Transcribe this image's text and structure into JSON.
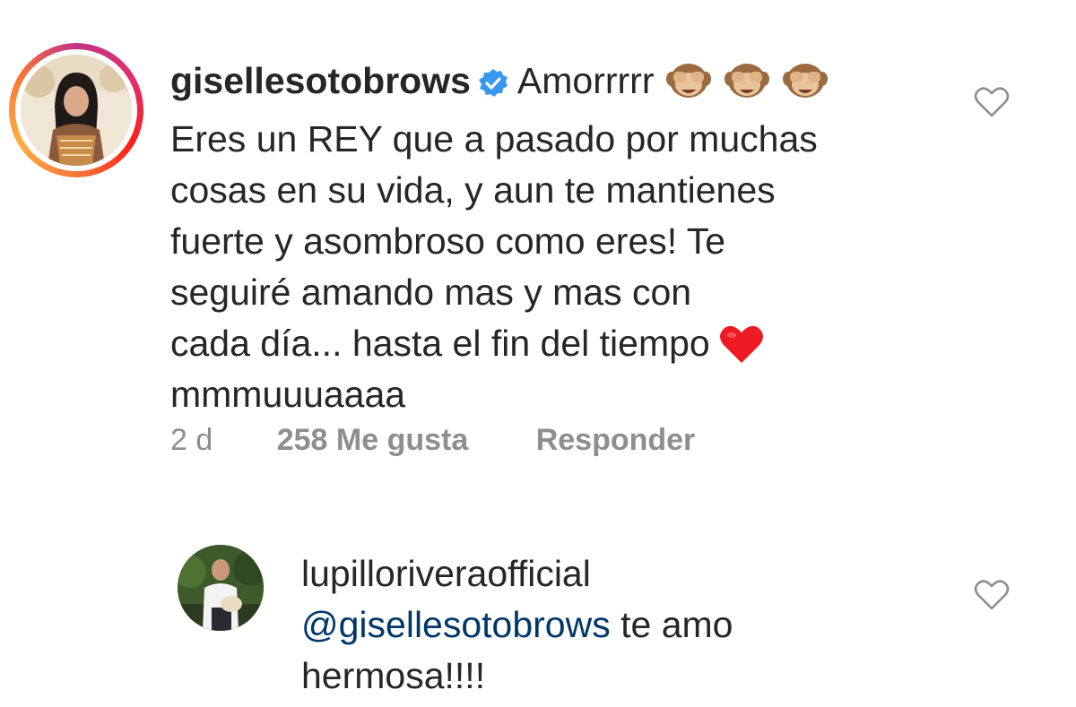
{
  "comments": [
    {
      "username": "gisellesotobrows",
      "verified": true,
      "text_first": "Amorrrrr",
      "emojis": [
        "see-no-evil-monkey",
        "see-no-evil-monkey",
        "see-no-evil-monkey"
      ],
      "lines": [
        "Eres un REY que a pasado por muchas",
        "cosas en su vida, y aun te mantienes",
        "fuerte y asombroso como eres! Te",
        "seguiré amando mas y mas con",
        "cada día... hasta el fin del tiempo",
        "mmmuuuaaaa"
      ],
      "trailing_emoji": "red-heart",
      "time": "2 d",
      "likes": "258 Me gusta",
      "reply_label": "Responder",
      "has_story_ring": true
    },
    {
      "username": "lupilloriveraofficial",
      "mention": "@gisellesotobrows",
      "text_after_mention": " te amo",
      "line2": "hermosa!!!!"
    }
  ],
  "colors": {
    "text": "#262626",
    "meta": "#8e8e8e",
    "mention": "#00376b",
    "verified": "#3897f0",
    "heart": "#ed1c24"
  }
}
